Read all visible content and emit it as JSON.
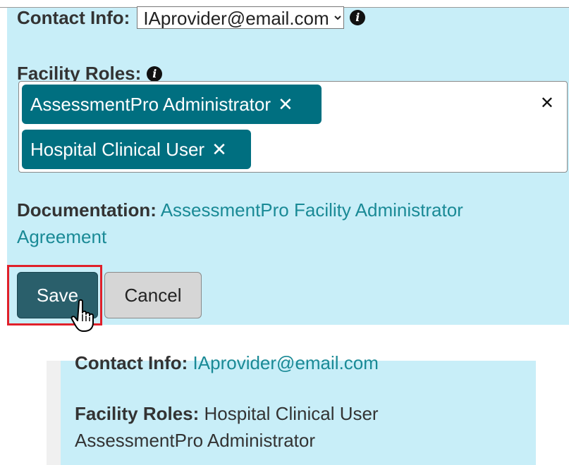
{
  "edit_form": {
    "contact_label": "Contact Info:",
    "contact_selected": "IAprovider@email.com",
    "roles_label": "Facility Roles:",
    "roles": [
      {
        "label": "AssessmentPro Administrator",
        "remove": "✕"
      },
      {
        "label": "Hospital Clinical User",
        "remove": "✕"
      }
    ],
    "clear_all": "✕",
    "doc_label": "Documentation:",
    "doc_link": "AssessmentPro Facility Administrator Agreement",
    "save_label": "Save",
    "cancel_label": "Cancel"
  },
  "saved_view": {
    "contact_label": "Contact Info:",
    "contact_value": "IAprovider@email.com",
    "roles_label": "Facility Roles:",
    "roles": [
      "Hospital Clinical User",
      "AssessmentPro Administrator"
    ]
  },
  "colors": {
    "panel_bg": "#c8eef8",
    "chip_bg": "#006f80",
    "save_bg": "#2a5f6b",
    "link": "#1a8a96",
    "highlight": "#e0202a"
  },
  "icons": {
    "info": "info-circle-icon",
    "cursor": "hand-pointer-icon"
  }
}
